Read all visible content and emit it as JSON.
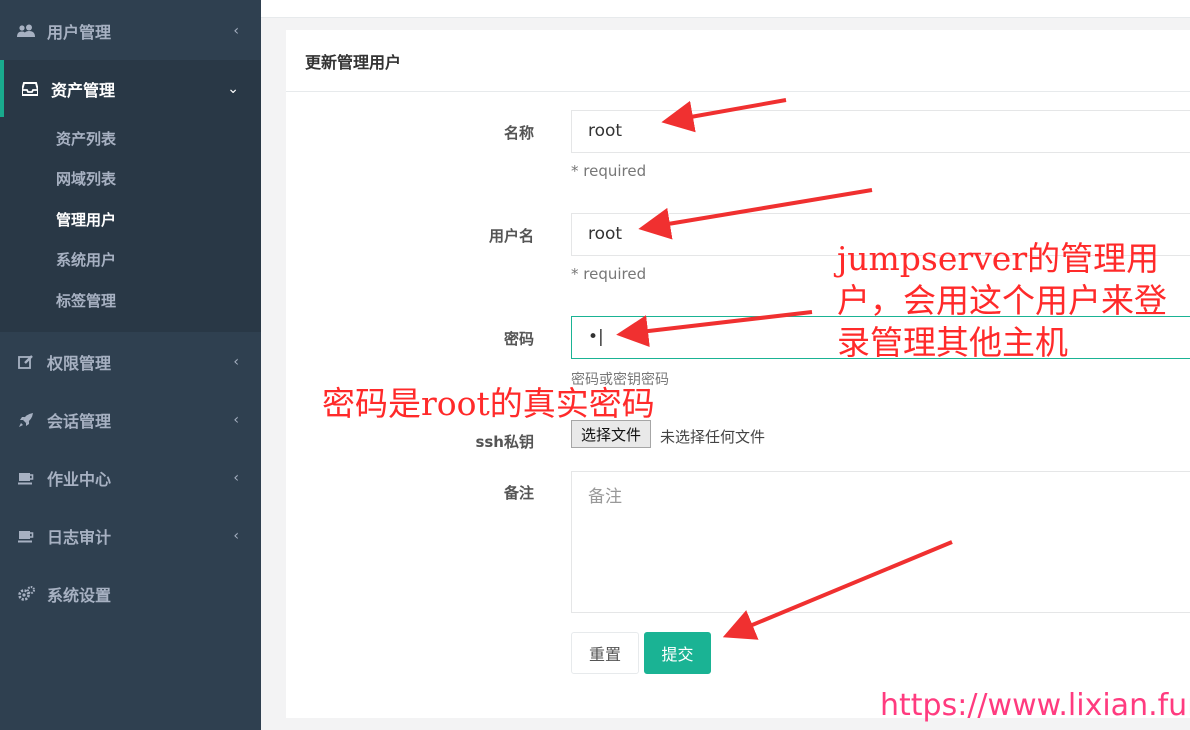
{
  "sidebar": {
    "items": [
      {
        "label": "用户管理",
        "icon": "users-icon"
      },
      {
        "label": "资产管理",
        "icon": "inbox-icon"
      },
      {
        "label": "权限管理",
        "icon": "edit-icon"
      },
      {
        "label": "会话管理",
        "icon": "rocket-icon"
      },
      {
        "label": "作业中心",
        "icon": "coffee-icon"
      },
      {
        "label": "日志审计",
        "icon": "coffee-icon"
      },
      {
        "label": "系统设置",
        "icon": "gears-icon"
      }
    ],
    "submenu": [
      "资产列表",
      "网域列表",
      "管理用户",
      "系统用户",
      "标签管理"
    ],
    "active_sub": "管理用户"
  },
  "panel": {
    "title": "更新管理用户"
  },
  "form": {
    "name_label": "名称",
    "name_value": "root",
    "name_help": "* required",
    "username_label": "用户名",
    "username_value": "root",
    "username_help": "* required",
    "password_label": "密码",
    "password_value": "•",
    "password_help": "密码或密钥密码",
    "sshkey_label": "ssh私钥",
    "file_button": "选择文件",
    "file_status": "未选择任何文件",
    "comment_label": "备注",
    "comment_placeholder": "备注",
    "reset_label": "重置",
    "submit_label": "提交"
  },
  "annotations": {
    "admin_note": "jumpserver的管理用户，会用这个用户来登录管理其他主机",
    "password_note": "密码是root的真实密码",
    "watermark": "https://www.lixian.fun"
  },
  "colors": {
    "sidebar_bg": "#2f4050",
    "accent": "#1ab394",
    "annotation": "#ff2a2a"
  }
}
